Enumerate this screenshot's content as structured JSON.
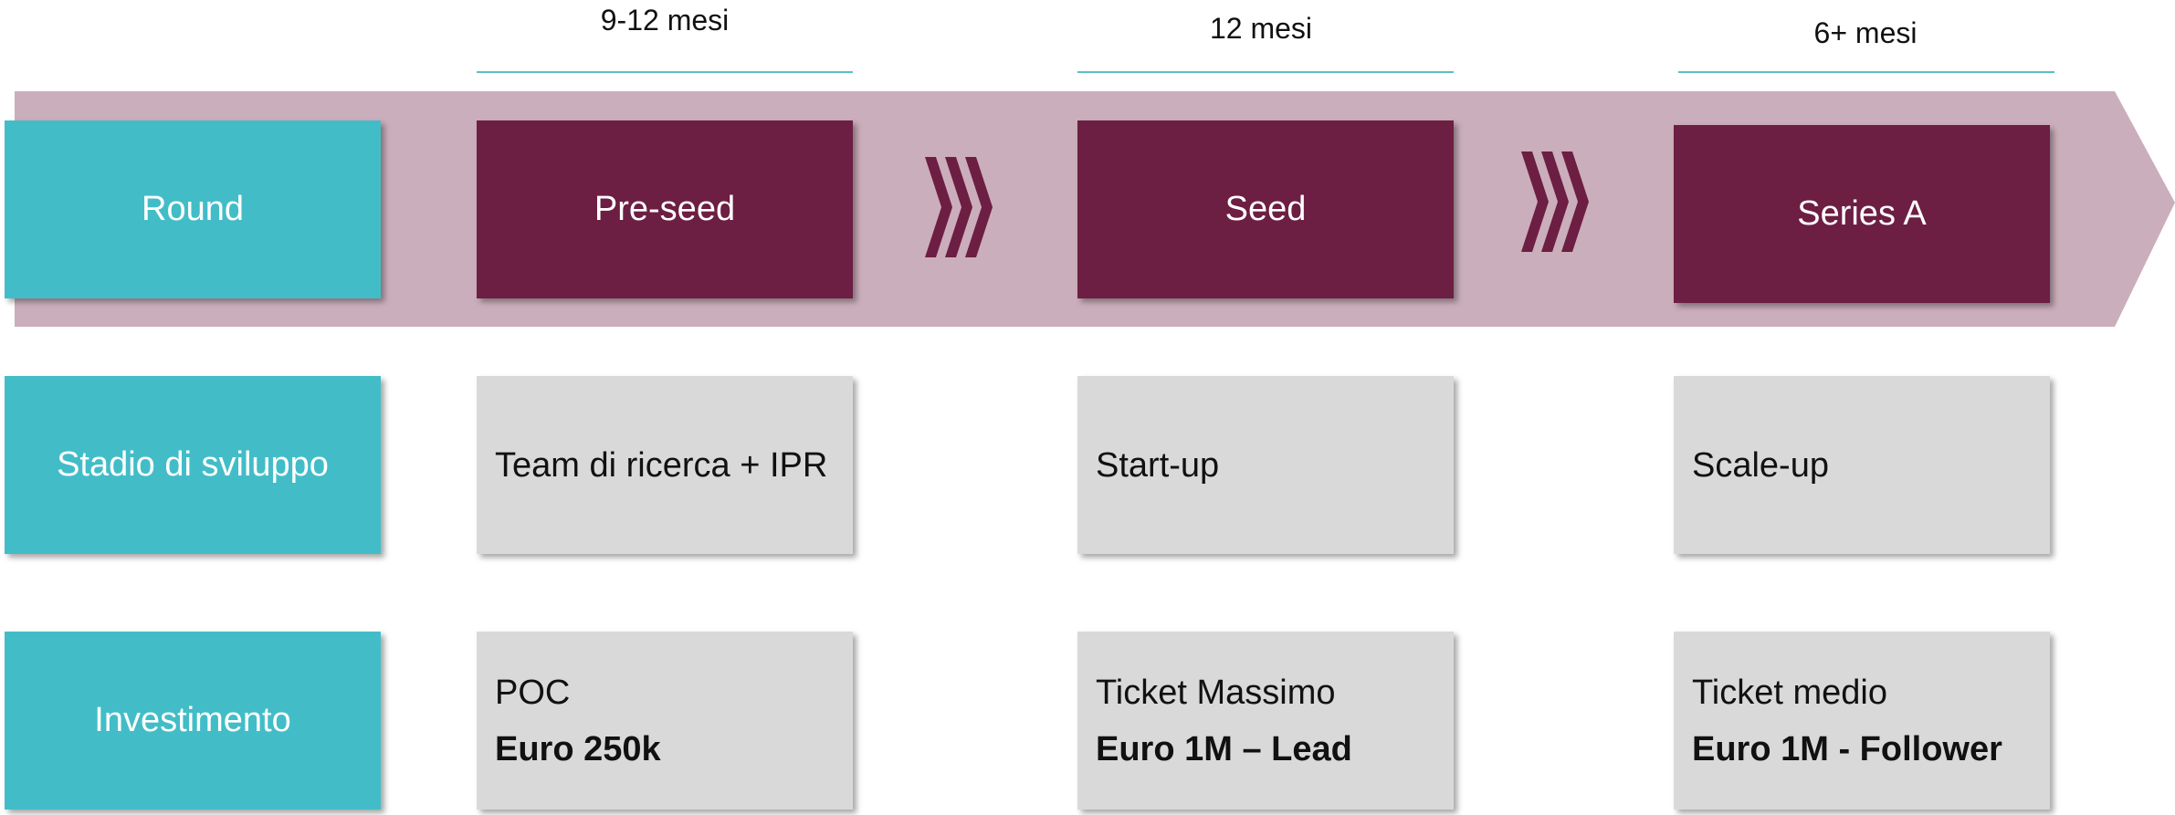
{
  "colors": {
    "band": "#cbaebb",
    "teal": "#42bdc8",
    "maroon": "#6d1e43",
    "grey": "#d9d9d9",
    "line": "#5bbfc4"
  },
  "durations": [
    "9-12 mesi",
    "12 mesi",
    "6+ mesi"
  ],
  "labels": {
    "round": "Round",
    "stage": "Stadio di sviluppo",
    "investment": "Investimento"
  },
  "rounds": [
    "Pre-seed",
    "Seed",
    "Series A"
  ],
  "stages": [
    "Team di ricerca + IPR",
    "Start-up",
    "Scale-up"
  ],
  "investments": [
    {
      "line1": "POC",
      "line2": "Euro 250k"
    },
    {
      "line1": "Ticket Massimo",
      "line2": "Euro 1M – Lead"
    },
    {
      "line1": "Ticket medio",
      "line2": "Euro 1M - Follower"
    }
  ]
}
